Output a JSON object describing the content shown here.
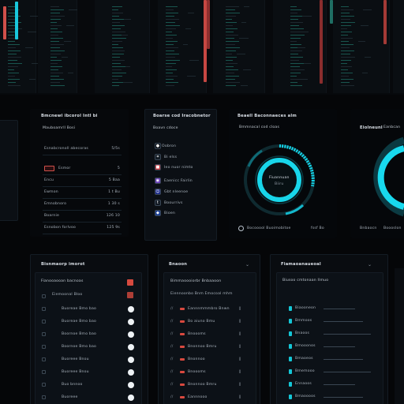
{
  "colors": {
    "accent": "#14d4e8",
    "danger": "#d8493f",
    "bg": "#050608",
    "panel": "#0b0f14",
    "ok": "#1f6e63"
  },
  "left_panel": {
    "title": "Bmcnewi ibcorol Intl bi",
    "subtitle": "Mauboamrll Bosi",
    "rows": [
      {
        "label": "Esnabcronoll abecoras",
        "value": "5/5s"
      },
      {
        "label": "Esmor",
        "value": "5"
      },
      {
        "label": "Encu",
        "value": "5 Baa"
      },
      {
        "label": "Ewmon",
        "value": "1 t Bu"
      },
      {
        "label": "Emnobnoro",
        "value": "1 30 s"
      },
      {
        "label": "Boarnie",
        "value": "126 10"
      },
      {
        "label": "Esnobon forlvoo",
        "value": "125 9s"
      }
    ]
  },
  "apps_panel": {
    "title": "Boarse cod Iracobnetor",
    "subtitle": "Boavn cdoce",
    "items": [
      {
        "label": "Oobron",
        "icon": "circle-icon"
      },
      {
        "label": "Bi elss",
        "icon": "crop-icon"
      },
      {
        "label": "Ieo nuor nimto",
        "icon": "red-square-icon"
      },
      {
        "label": "Eaenicc Fairlin",
        "icon": "purple-circle-icon"
      },
      {
        "label": "Gbt nleenoe",
        "icon": "user-icon"
      },
      {
        "label": "Boourrivs",
        "icon": "tumblr-icon"
      },
      {
        "label": "Bioen",
        "icon": "blue-badge-icon"
      }
    ]
  },
  "ring_panel": {
    "title": "Beaell Baconnaeces alm",
    "subtitle": "Bmmnacal cod cloas",
    "center_label": "Fiuannuan",
    "center_sub": "Biiru",
    "footer_label": "Bocooool Buoimobitoe",
    "footer_value": "fssf Bo",
    "icon": "clock-icon"
  },
  "right_panel": {
    "title": "Eiolneunl",
    "subtitle": "Eanbcan",
    "footer_label": "Bnbaocn",
    "footer_value": "Boooslon"
  },
  "tasks_panel": {
    "title": "Bisnmaorp imorot",
    "header": "Fianooaooan bacnoas",
    "sub": "Eiemoonal Bloo",
    "rows": [
      "Buoreae Bmo bao",
      "Buoreae Bmo bao",
      "Boornoe Bmo bao",
      "Boornoe Bmo bao",
      "Buoreee Bnou",
      "Buoreee Bnou",
      "Buo bnnoo",
      "Buoreee"
    ]
  },
  "log_panel": {
    "title": "Bnaoon",
    "header": "Bimmaoooiorbr Bnbaaoon",
    "sub": "Eiennoonbo Bnm Emocoal mhm",
    "rows": [
      "Eannnmmmbro Bnwn",
      "Bo aiuno Bmu",
      "Bnoooms",
      "Bnonnoo Bmru",
      "Bnonnoo",
      "Bnoooms",
      "Bnonnoo Bmru",
      "Eannnooo"
    ]
  },
  "metrics_panel": {
    "title": "Fiamaoanaueoal",
    "header": "Biusoo cmtonaan llmuo",
    "rows": [
      "Biaooneon",
      "Bmmoos",
      "Bnaoos",
      "Bmooonos",
      "Bmaoeos",
      "Bmemooo",
      "Ennaoos",
      "Bmaoooos"
    ]
  }
}
